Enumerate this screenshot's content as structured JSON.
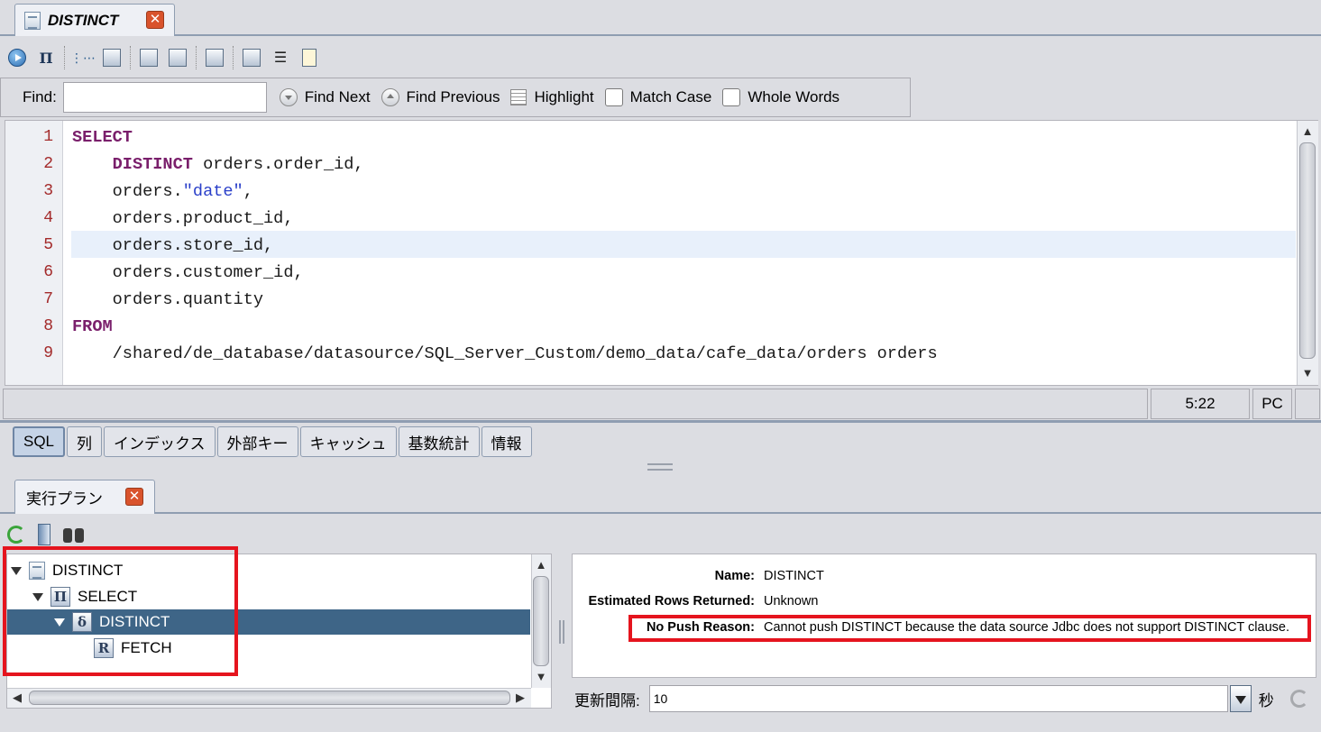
{
  "editor_tab": {
    "title": "DISTINCT",
    "close": "✕"
  },
  "find": {
    "label": "Find:",
    "value": "",
    "find_next": "Find Next",
    "find_previous": "Find Previous",
    "highlight": "Highlight",
    "match_case": "Match Case",
    "whole_words": "Whole Words"
  },
  "code": {
    "line_numbers": [
      "1",
      "2",
      "3",
      "4",
      "5",
      "6",
      "7",
      "8",
      "9"
    ],
    "lines": [
      {
        "kw": "SELECT",
        "rest": ""
      },
      {
        "indent": "    ",
        "kw": "DISTINCT",
        "rest": " orders.order_id,"
      },
      {
        "indent": "    ",
        "pre": "orders.",
        "str": "\"date\"",
        "rest": ","
      },
      {
        "indent": "    ",
        "rest": "orders.product_id,"
      },
      {
        "indent": "    ",
        "rest": "orders.store_id,"
      },
      {
        "indent": "    ",
        "rest": "orders.customer_id,"
      },
      {
        "indent": "    ",
        "rest": "orders.quantity"
      },
      {
        "kw": "FROM",
        "rest": ""
      },
      {
        "indent": "    ",
        "rest": "/shared/de_database/datasource/SQL_Server_Custom/demo_data/cafe_data/orders orders"
      }
    ],
    "current_line": 5
  },
  "status": {
    "position": "5:22",
    "line_ending": "PC"
  },
  "lower_tabs": [
    "SQL",
    "列",
    "インデックス",
    "外部キー",
    "キャッシュ",
    "基数統計",
    "情報"
  ],
  "plan_tab": {
    "title": "実行プラン",
    "close": "✕"
  },
  "tree": {
    "nodes": [
      {
        "label": "DISTINCT",
        "icon": "document-icon",
        "expanded": true
      },
      {
        "label": "SELECT",
        "icon": "pi-icon",
        "glyph": "Π",
        "expanded": true
      },
      {
        "label": "DISTINCT",
        "icon": "delta-icon",
        "glyph": "δ",
        "expanded": true,
        "selected": true
      },
      {
        "label": "FETCH",
        "icon": "relation-icon",
        "glyph": "R"
      }
    ]
  },
  "properties": {
    "name_key": "Name:",
    "name_val": "DISTINCT",
    "rows_key": "Estimated Rows Returned:",
    "rows_val": "Unknown",
    "reason_key": "No Push Reason:",
    "reason_val": "Cannot push DISTINCT because the data source Jdbc does not support DISTINCT clause."
  },
  "interval": {
    "label": "更新間隔:",
    "value": "10",
    "unit": "秒"
  },
  "colors": {
    "highlight_red": "#e5141e",
    "selection": "#3e6587",
    "keyword": "#7a1f6b",
    "string": "#2a3fc9"
  }
}
